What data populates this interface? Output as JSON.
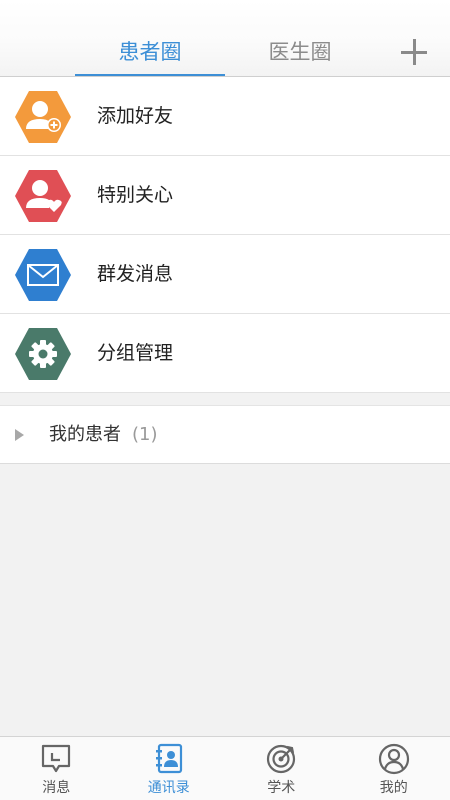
{
  "header": {
    "tabs": [
      {
        "label": "患者圈",
        "active": true
      },
      {
        "label": "医生圈",
        "active": false
      }
    ],
    "add_icon": "plus-icon"
  },
  "menu": [
    {
      "label": "添加好友",
      "icon": "add-friend-icon",
      "color": "#f39a3c"
    },
    {
      "label": "特别关心",
      "icon": "special-care-icon",
      "color": "#e04f55"
    },
    {
      "label": "群发消息",
      "icon": "mass-message-icon",
      "color": "#2f7fd0"
    },
    {
      "label": "分组管理",
      "icon": "group-settings-icon",
      "color": "#4a7a6a"
    }
  ],
  "group": {
    "label": "我的患者",
    "count": "(1)"
  },
  "bottom_nav": [
    {
      "label": "消息",
      "icon": "message-icon",
      "active": false
    },
    {
      "label": "通讯录",
      "icon": "contacts-icon",
      "active": true
    },
    {
      "label": "学术",
      "icon": "academic-icon",
      "active": false
    },
    {
      "label": "我的",
      "icon": "profile-icon",
      "active": false
    }
  ],
  "colors": {
    "accent": "#3d8fd6",
    "inactive_tab": "#8c8c8c",
    "background": "#f2f2f2"
  }
}
